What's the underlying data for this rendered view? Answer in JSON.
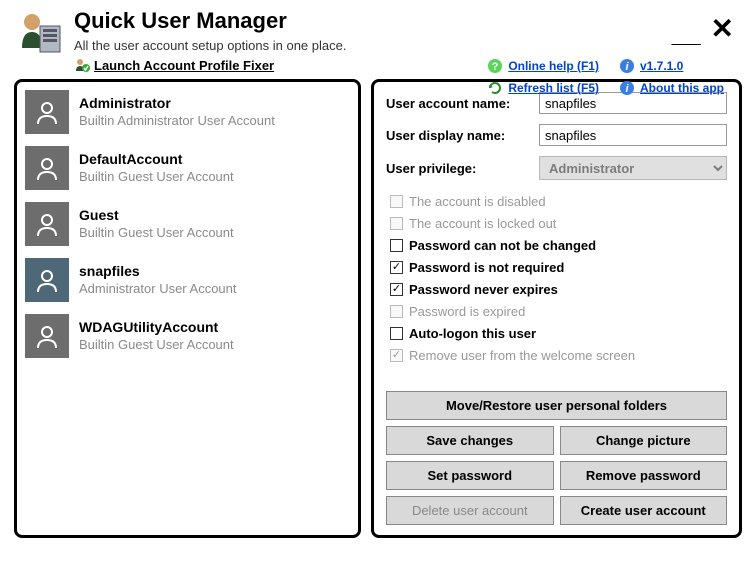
{
  "header": {
    "title": "Quick User Manager",
    "subtitle": "All the user account setup options in one place.",
    "profile_fixer": "Launch Account Profile Fixer",
    "links": {
      "online_help": "Online help (F1)",
      "version": "v1.7.1.0",
      "refresh": "Refresh list (F5)",
      "about": "About this app"
    }
  },
  "users": [
    {
      "name": "Administrator",
      "desc": "Builtin Administrator User Account"
    },
    {
      "name": "DefaultAccount",
      "desc": "Builtin Guest User Account"
    },
    {
      "name": "Guest",
      "desc": "Builtin Guest User Account"
    },
    {
      "name": "snapfiles",
      "desc": "Administrator User Account"
    },
    {
      "name": "WDAGUtilityAccount",
      "desc": "Builtin Guest User Account"
    }
  ],
  "selected_index": 3,
  "form": {
    "labels": {
      "account_name": "User account name:",
      "display_name": "User display name:",
      "privilege": "User privilege:"
    },
    "values": {
      "account_name": "snapfiles",
      "display_name": "snapfiles",
      "privilege": "Administrator"
    }
  },
  "checkboxes": [
    {
      "label": "The account is disabled",
      "checked": false,
      "enabled": false,
      "bold": false
    },
    {
      "label": "The account is locked out",
      "checked": false,
      "enabled": false,
      "bold": false
    },
    {
      "label": "Password can not be changed",
      "checked": false,
      "enabled": true,
      "bold": true
    },
    {
      "label": "Password is not required",
      "checked": true,
      "enabled": true,
      "bold": true
    },
    {
      "label": "Password never expires",
      "checked": true,
      "enabled": true,
      "bold": true
    },
    {
      "label": "Password is expired",
      "checked": false,
      "enabled": false,
      "bold": false
    },
    {
      "label": "Auto-logon this user",
      "checked": false,
      "enabled": true,
      "bold": true
    },
    {
      "label": "Remove user from the welcome screen",
      "checked": true,
      "enabled": false,
      "bold": false
    }
  ],
  "buttons": {
    "move_restore": "Move/Restore user personal folders",
    "save": "Save changes",
    "change_pic": "Change picture",
    "set_pwd": "Set password",
    "remove_pwd": "Remove password",
    "delete": "Delete user account",
    "create": "Create user account"
  }
}
